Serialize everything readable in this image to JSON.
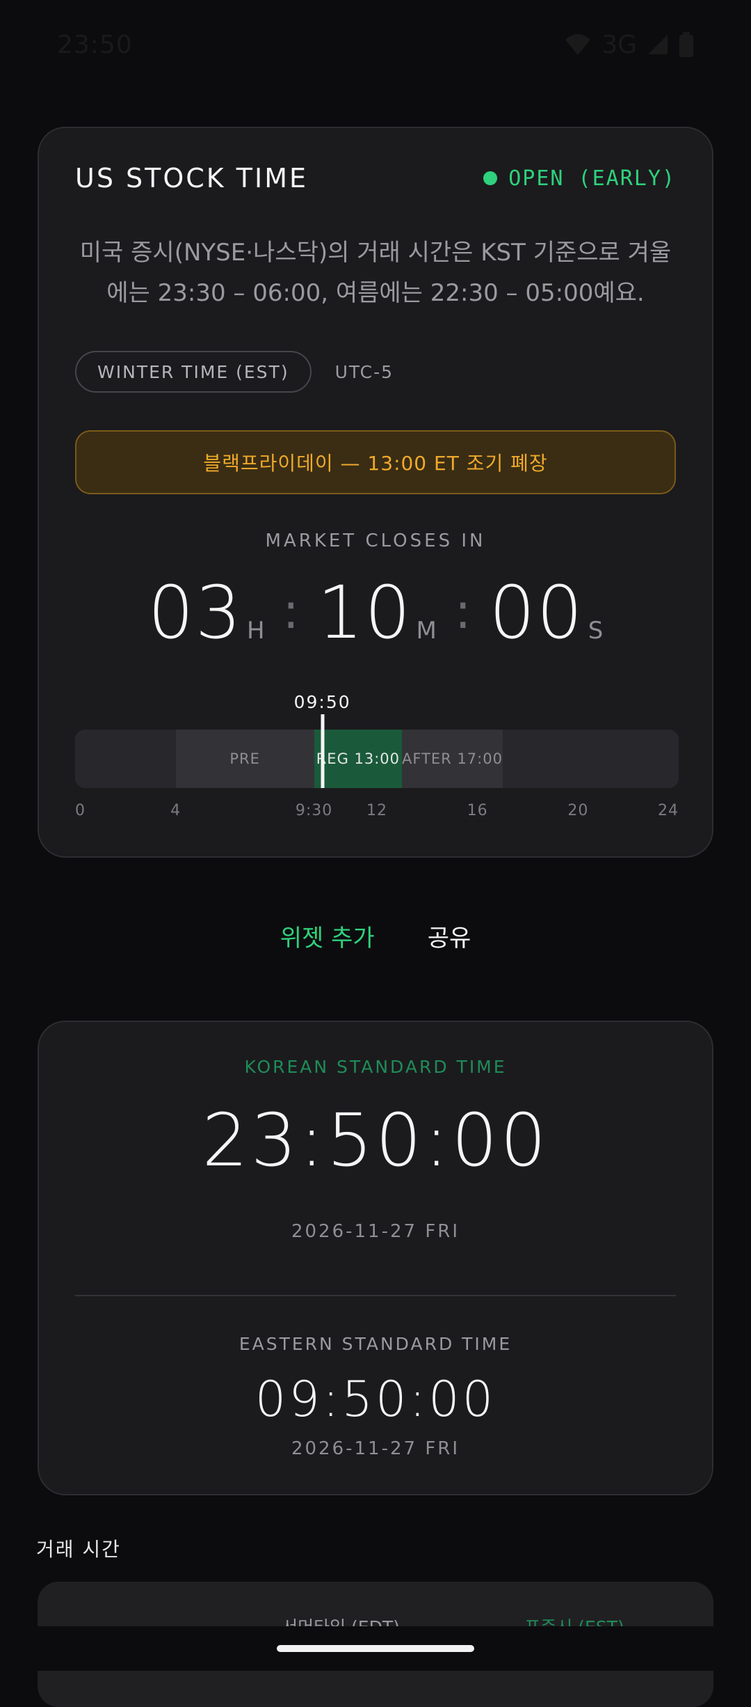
{
  "status_bar": {
    "time": "23:50",
    "network": "3G"
  },
  "header": {
    "title": "US STOCK TIME",
    "status": "OPEN (EARLY)",
    "status_color": "#2fd17c"
  },
  "description": "미국 증시(NYSE·나스닥)의 거래 시간은 KST 기준으로 겨울에는 23:30 – 06:00, 여름에는 22:30 – 05:00예요.",
  "mode": {
    "pill": "WINTER TIME (EST)",
    "utc": "UTC-5"
  },
  "banner": "블랙프라이데이 — 13:00 ET 조기 폐장",
  "countdown": {
    "label": "MARKET CLOSES IN",
    "hours": "03",
    "minutes": "10",
    "seconds": "00",
    "h_unit": "H",
    "m_unit": "M",
    "s_unit": "S"
  },
  "timeline": {
    "now_label": "09:50",
    "now_hour": 9.833,
    "segments": [
      {
        "name": "pre",
        "label": "PRE",
        "start": 4,
        "end": 9.5
      },
      {
        "name": "reg",
        "label": "REG 13:00",
        "start": 9.5,
        "end": 13
      },
      {
        "name": "after",
        "label": "AFTER 17:00",
        "start": 13,
        "end": 17
      }
    ],
    "ticks": [
      {
        "label": "0",
        "hour": 0
      },
      {
        "label": "4",
        "hour": 4
      },
      {
        "label": "9:30",
        "hour": 9.5
      },
      {
        "label": "12",
        "hour": 12
      },
      {
        "label": "16",
        "hour": 16
      },
      {
        "label": "20",
        "hour": 20
      },
      {
        "label": "24",
        "hour": 24
      }
    ]
  },
  "actions": {
    "add_widget": "위젯 추가",
    "share": "공유"
  },
  "kst": {
    "label": "KOREAN STANDARD TIME",
    "time": "23:50:00",
    "date": "2026-11-27 FRI",
    "label_color": "#1f8c57"
  },
  "est": {
    "label": "EASTERN STANDARD TIME",
    "time": "09:50:00",
    "date": "2026-11-27 FRI"
  },
  "trading_hours": {
    "title": "거래 시간",
    "col_summer": "서머타임 (EDT)",
    "col_standard": "표준시 (EST)"
  }
}
